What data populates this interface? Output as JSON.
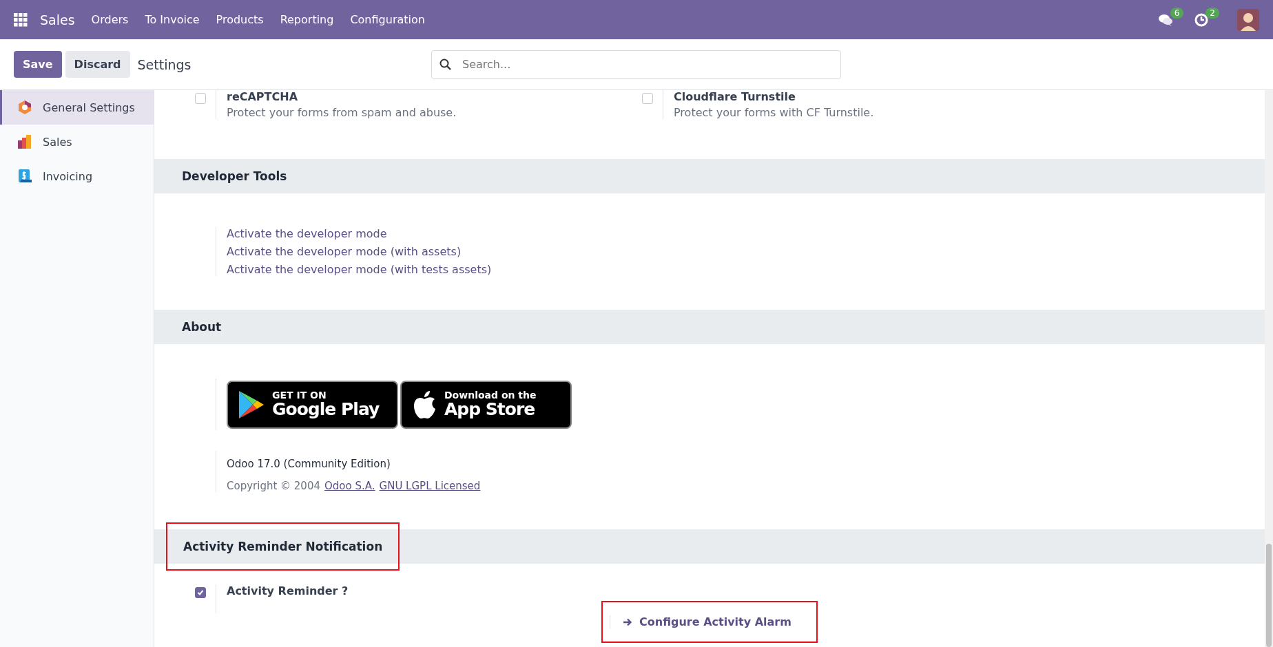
{
  "navbar": {
    "app": "Sales",
    "menu": [
      "Orders",
      "To Invoice",
      "Products",
      "Reporting",
      "Configuration"
    ],
    "messages_count": "6",
    "activities_count": "2"
  },
  "control_panel": {
    "save": "Save",
    "discard": "Discard",
    "title": "Settings",
    "search": {
      "placeholder": "Search..."
    }
  },
  "sidebar": {
    "items": [
      {
        "label": "General Settings",
        "kind": "general",
        "selected": true
      },
      {
        "label": "Sales",
        "kind": "sales",
        "selected": false
      },
      {
        "label": "Invoicing",
        "kind": "invoicing",
        "selected": false
      }
    ]
  },
  "top_options": [
    {
      "title": "reCAPTCHA",
      "description": "Protect your forms from spam and abuse.",
      "checked": false
    },
    {
      "title": "Cloudflare Turnstile",
      "description": "Protect your forms with CF Turnstile.",
      "checked": false
    }
  ],
  "developer_tools": {
    "title": "Developer Tools",
    "links": [
      "Activate the developer mode",
      "Activate the developer mode (with assets)",
      "Activate the developer mode (with tests assets)"
    ]
  },
  "about": {
    "title": "About",
    "google_play": {
      "small": "GET IT ON",
      "big": "Google Play"
    },
    "app_store": {
      "small": "Download on the",
      "big": "App Store"
    },
    "version": "Odoo 17.0 (Community Edition)",
    "copyright": "Copyright © 2004",
    "company_link": "Odoo S.A.",
    "license_link": "GNU LGPL Licensed"
  },
  "activity": {
    "title": "Activity Reminder Notification",
    "highlighted": true,
    "option": {
      "label": "Activity Reminder ?",
      "checked": true
    },
    "configure": {
      "label": "Configure Activity Alarm",
      "highlighted": true
    }
  }
}
